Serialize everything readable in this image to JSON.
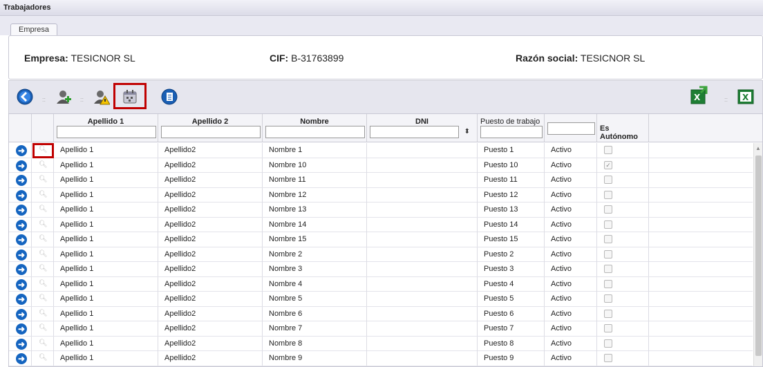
{
  "window": {
    "title": "Trabajadores"
  },
  "tabs": [
    {
      "label": "Empresa"
    }
  ],
  "info": {
    "empresa_label": "Empresa:",
    "empresa_value": "TESICNOR SL",
    "cif_label": "CIF:",
    "cif_value": "B-31763899",
    "razon_label": "Razón social:",
    "razon_value": "TESICNOR SL"
  },
  "toolbar": {
    "icons": [
      "back-icon",
      "add-worker-icon",
      "worker-warning-icon",
      "calendar-icon",
      "document-icon",
      "excel-export-icon",
      "excel-icon"
    ]
  },
  "grid": {
    "headers": [
      "Apellido 1",
      "Apellido 2",
      "Nombre",
      "DNI",
      "Puesto de trabajo",
      "",
      "Es Autónomo"
    ],
    "rows": [
      {
        "a1": "Apellido 1",
        "a2": "Apellido2",
        "nombre": "Nombre 1",
        "dni": "",
        "puesto": "Puesto 1",
        "estado": "Activo",
        "autonomo": false
      },
      {
        "a1": "Apellido 1",
        "a2": "Apellido2",
        "nombre": "Nombre 10",
        "dni": "",
        "puesto": "Puesto 10",
        "estado": "Activo",
        "autonomo": true
      },
      {
        "a1": "Apellido 1",
        "a2": "Apellido2",
        "nombre": "Nombre 11",
        "dni": "",
        "puesto": "Puesto 11",
        "estado": "Activo",
        "autonomo": false
      },
      {
        "a1": "Apellido 1",
        "a2": "Apellido2",
        "nombre": "Nombre 12",
        "dni": "",
        "puesto": "Puesto 12",
        "estado": "Activo",
        "autonomo": false
      },
      {
        "a1": "Apellido 1",
        "a2": "Apellido2",
        "nombre": "Nombre 13",
        "dni": "",
        "puesto": "Puesto 13",
        "estado": "Activo",
        "autonomo": false
      },
      {
        "a1": "Apellido 1",
        "a2": "Apellido2",
        "nombre": "Nombre 14",
        "dni": "",
        "puesto": "Puesto 14",
        "estado": "Activo",
        "autonomo": false
      },
      {
        "a1": "Apellido 1",
        "a2": "Apellido2",
        "nombre": "Nombre 15",
        "dni": "",
        "puesto": "Puesto 15",
        "estado": "Activo",
        "autonomo": false
      },
      {
        "a1": "Apellido 1",
        "a2": "Apellido2",
        "nombre": "Nombre 2",
        "dni": "",
        "puesto": "Puesto 2",
        "estado": "Activo",
        "autonomo": false
      },
      {
        "a1": "Apellido 1",
        "a2": "Apellido2",
        "nombre": "Nombre 3",
        "dni": "",
        "puesto": "Puesto 3",
        "estado": "Activo",
        "autonomo": false
      },
      {
        "a1": "Apellido 1",
        "a2": "Apellido2",
        "nombre": "Nombre 4",
        "dni": "",
        "puesto": "Puesto 4",
        "estado": "Activo",
        "autonomo": false
      },
      {
        "a1": "Apellido 1",
        "a2": "Apellido2",
        "nombre": "Nombre 5",
        "dni": "",
        "puesto": "Puesto 5",
        "estado": "Activo",
        "autonomo": false
      },
      {
        "a1": "Apellido 1",
        "a2": "Apellido2",
        "nombre": "Nombre 6",
        "dni": "",
        "puesto": "Puesto 6",
        "estado": "Activo",
        "autonomo": false
      },
      {
        "a1": "Apellido 1",
        "a2": "Apellido2",
        "nombre": "Nombre 7",
        "dni": "",
        "puesto": "Puesto 7",
        "estado": "Activo",
        "autonomo": false
      },
      {
        "a1": "Apellido 1",
        "a2": "Apellido2",
        "nombre": "Nombre 8",
        "dni": "",
        "puesto": "Puesto 8",
        "estado": "Activo",
        "autonomo": false
      },
      {
        "a1": "Apellido 1",
        "a2": "Apellido2",
        "nombre": "Nombre 9",
        "dni": "",
        "puesto": "Puesto 9",
        "estado": "Activo",
        "autonomo": false
      }
    ]
  },
  "colors": {
    "accent": "#1565c0",
    "highlight": "#c00000"
  }
}
